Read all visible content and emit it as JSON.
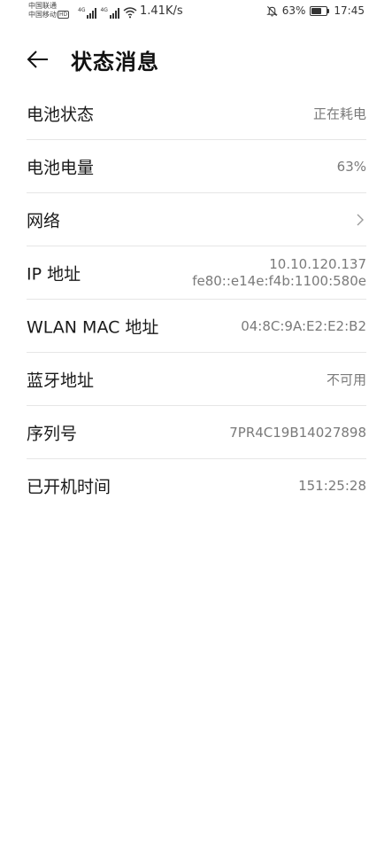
{
  "status_bar": {
    "carrier_1": "中国联通",
    "carrier_2": "中国移动",
    "hd_badge": "HD",
    "signal_1_tag": "4G",
    "signal_2_tag": "4G",
    "net_speed": "1.41K/s",
    "battery": "63%",
    "time": "17:45",
    "icons": [
      "signal-icon",
      "wifi-icon",
      "bell-off-icon",
      "battery-icon"
    ]
  },
  "header": {
    "title": "状态消息",
    "back_icon": "arrow-left-icon"
  },
  "items": [
    {
      "label": "电池状态",
      "value": "正在耗电"
    },
    {
      "label": "电池电量",
      "value": "63%"
    },
    {
      "label": "网络",
      "value": ""
    },
    {
      "label": "IP 地址",
      "value_lines": [
        "10.10.120.137",
        "fe80::e14e:f4b:1100:580e"
      ]
    },
    {
      "label": "WLAN MAC 地址",
      "value": "04:8C:9A:E2:E2:B2"
    },
    {
      "label": "蓝牙地址",
      "value": "不可用"
    },
    {
      "label": "序列号",
      "value": "7PR4C19B14027898"
    },
    {
      "label": "已开机时间",
      "value": "151:25:28"
    }
  ],
  "colors": {
    "background": "#ffffff",
    "label_text": "#1a1a1a",
    "value_text": "#7a7a7a",
    "divider": "#e6e6e6"
  }
}
